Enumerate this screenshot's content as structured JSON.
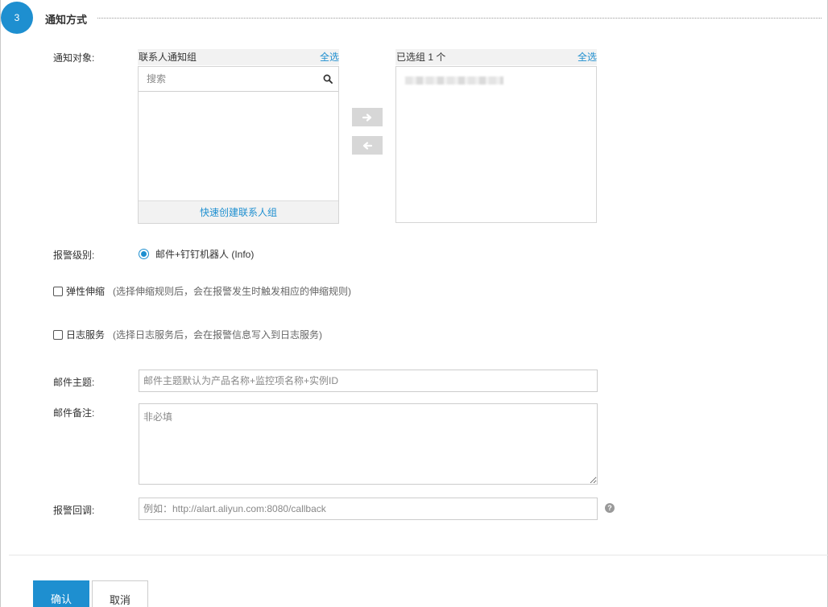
{
  "section": {
    "step_number": "3",
    "title": "通知方式"
  },
  "notify_target": {
    "label": "通知对象:",
    "left_panel": {
      "title": "联系人通知组",
      "select_all": "全选",
      "search_placeholder": "搜索",
      "search_icon": "search-icon",
      "create_link": "快速创建联系人组"
    },
    "right_panel": {
      "title": "已选组 1 个",
      "select_all": "全选"
    },
    "move_right_icon": "arrow-right-icon",
    "move_left_icon": "arrow-left-icon"
  },
  "alert_level": {
    "label": "报警级别:",
    "option_label": "邮件+钉钉机器人 (Info)",
    "selected": true
  },
  "elastic_scaling": {
    "title": "弹性伸缩",
    "hint": "(选择伸缩规则后，会在报警发生时触发相应的伸缩规则)",
    "checked": false
  },
  "log_service": {
    "title": "日志服务",
    "hint": "(选择日志服务后，会在报警信息写入到日志服务)",
    "checked": false
  },
  "email_subject": {
    "label": "邮件主题:",
    "placeholder": "邮件主题默认为产品名称+监控项名称+实例ID"
  },
  "email_note": {
    "label": "邮件备注:",
    "placeholder": "非必填"
  },
  "callback": {
    "label": "报警回调:",
    "placeholder": "例如：http://alart.aliyun.com:8080/callback",
    "help_icon": "question-circle-icon",
    "help_glyph": "?"
  },
  "actions": {
    "confirm": "确认",
    "cancel": "取消"
  },
  "colors": {
    "accent": "#1e8fd0",
    "panel_header_bg": "#f2f2f2",
    "arrow_button_bg": "#d7d7d7"
  }
}
